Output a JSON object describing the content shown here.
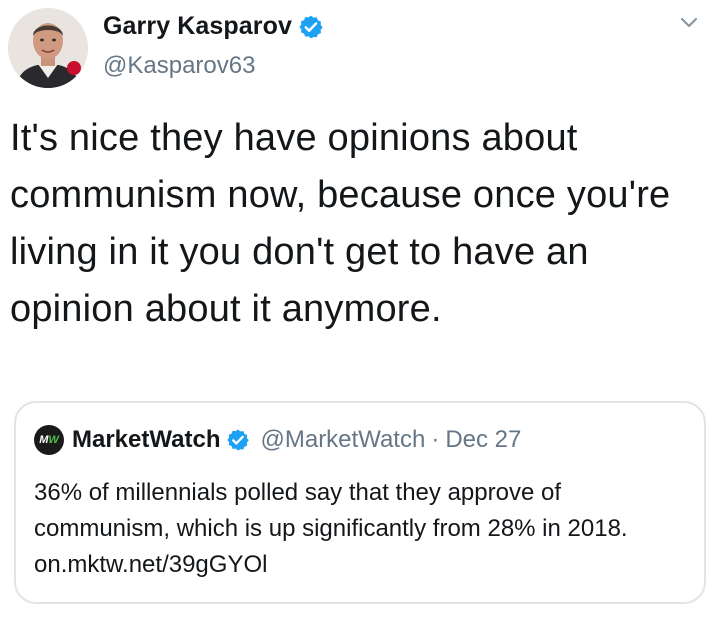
{
  "author": {
    "display_name": "Garry Kasparov",
    "handle": "@Kasparov63",
    "verified": true
  },
  "tweet": {
    "text": "It's nice they have opinions about communism now, because once you're living in it you don't get to have an opinion about it anymore."
  },
  "quoted_tweet": {
    "logo_text": "MW",
    "display_name": "MarketWatch",
    "handle": "@MarketWatch",
    "separator": "·",
    "date": "Dec 27",
    "text": "36% of millennials polled say that they approve of communism, which is up significantly from 28% in 2018. on.mktw.net/39gGYOl"
  },
  "icons": {
    "verified": "verified-badge-icon",
    "menu": "chevron-down-icon",
    "avatar": "avatar"
  },
  "colors": {
    "verified_blue": "#1da1f2",
    "secondary_text": "#657786",
    "primary_text": "#14171a",
    "border": "#dfe4e8",
    "mw_green": "#4cc14a"
  }
}
